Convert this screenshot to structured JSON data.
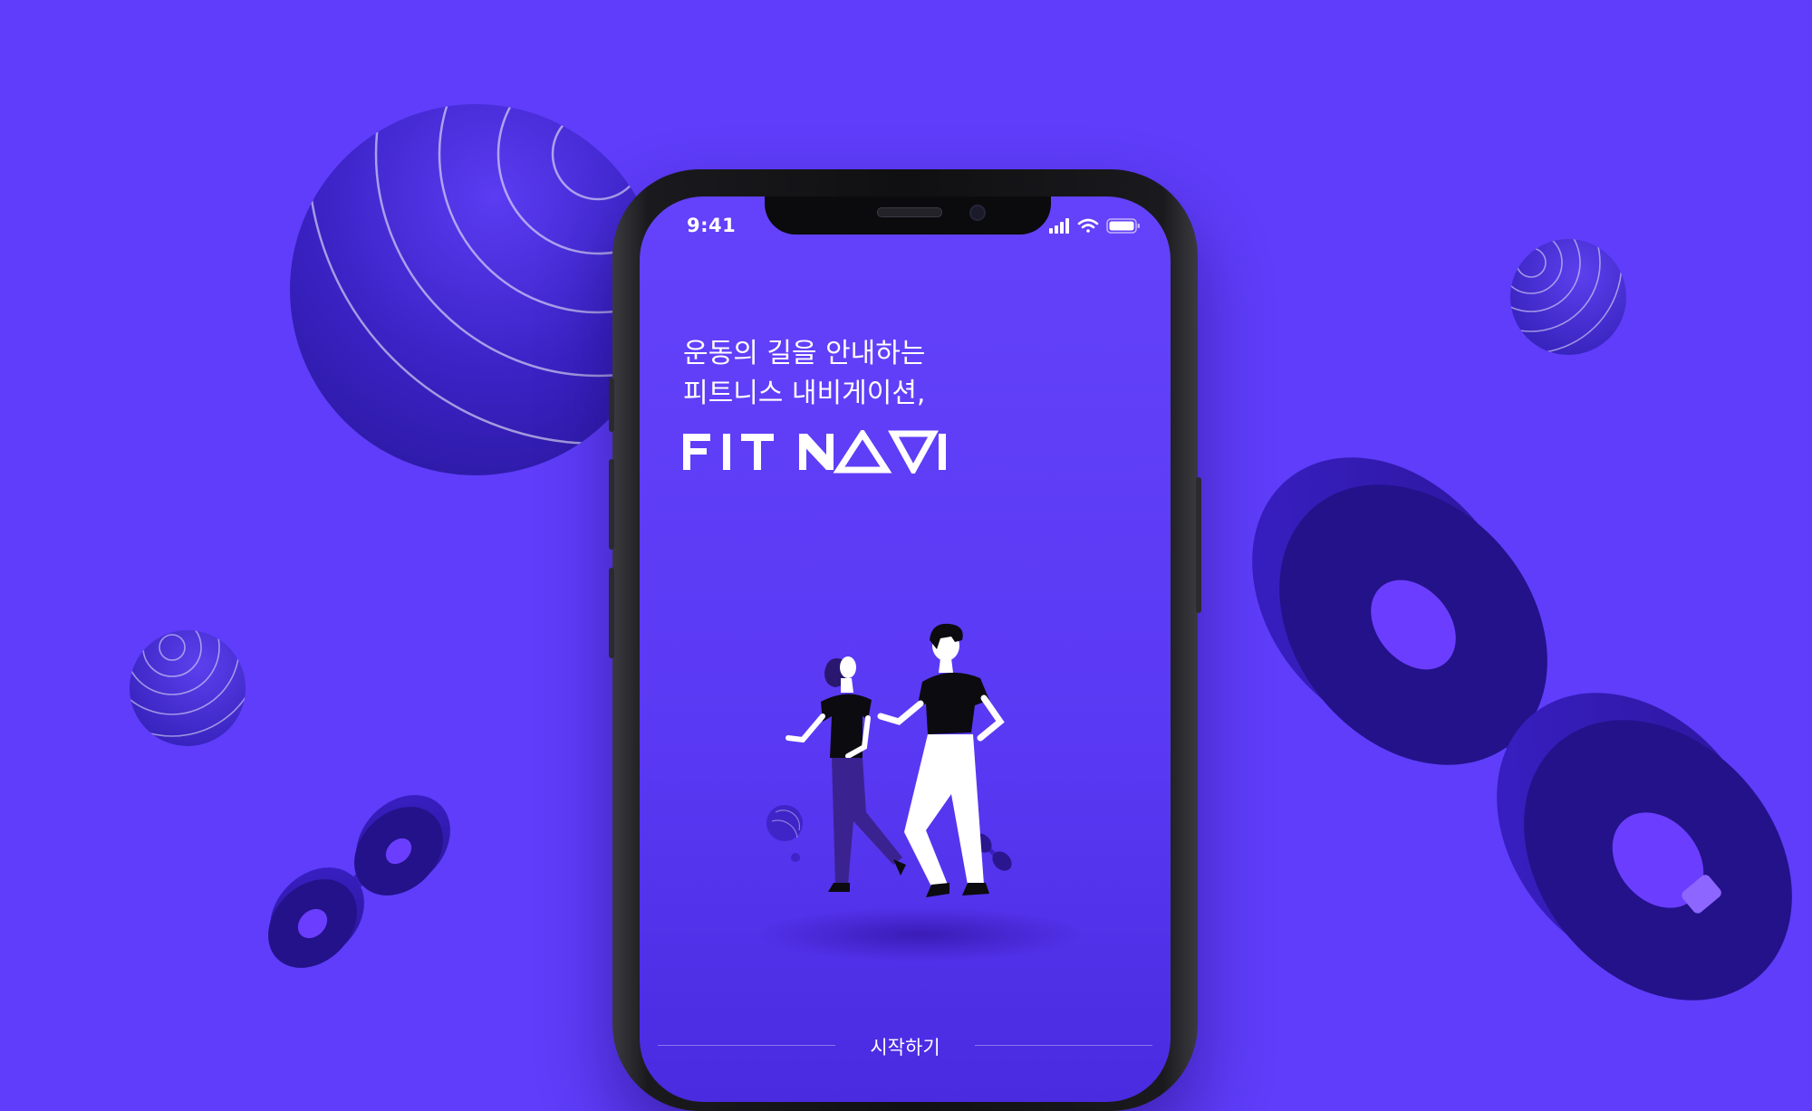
{
  "status_bar": {
    "time": "9:41"
  },
  "hero": {
    "line1": "운동의 길을 안내하는",
    "line2": "피트니스 내비게이션,",
    "logo_text": "FITNAVI"
  },
  "cta": {
    "start_label": "시작하기"
  },
  "colors": {
    "background": "#5f3dfa",
    "screen": "#6442fb",
    "object_dark": "#2b1a9e",
    "accent": "#6b3dff"
  },
  "icons": [
    "signal-icon",
    "wifi-icon",
    "battery-icon"
  ]
}
